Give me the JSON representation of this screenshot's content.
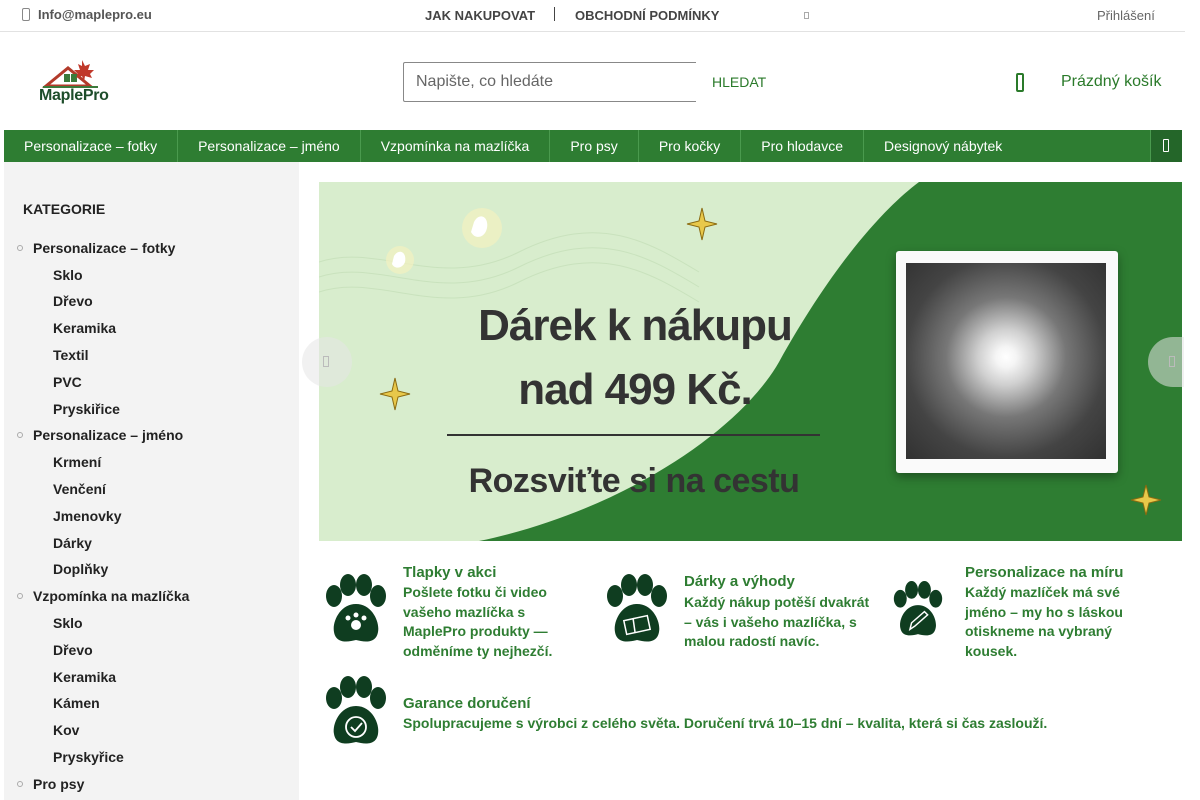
{
  "topbar": {
    "email": "Info@maplepro.eu",
    "links": [
      "JAK NAKUPOVAT",
      "OBCHODNÍ PODMÍNKY"
    ],
    "login": "Přihlášení"
  },
  "header": {
    "logo_text": "MaplePro",
    "search_placeholder": "Napište, co hledáte",
    "search_button": "HLEDAT",
    "cart_label": "Prázdný košík"
  },
  "nav": {
    "items": [
      "Personalizace – fotky",
      "Personalizace – jméno",
      "Vzpomínka na mazlíčka",
      "Pro psy",
      "Pro kočky",
      "Pro hlodavce",
      "Designový nábytek"
    ]
  },
  "sidebar": {
    "heading": "KATEGORIE",
    "categories": [
      {
        "label": "Personalizace – fotky",
        "children": [
          "Sklo",
          "Dřevo",
          "Keramika",
          "Textil",
          "PVC",
          "Pryskiřice"
        ]
      },
      {
        "label": "Personalizace – jméno",
        "children": [
          "Krmení",
          "Venčení",
          "Jmenovky",
          "Dárky",
          "Doplňky"
        ]
      },
      {
        "label": "Vzpomínka na mazlíčka",
        "children": [
          "Sklo",
          "Dřevo",
          "Keramika",
          "Kámen",
          "Kov",
          "Pryskyřice"
        ]
      },
      {
        "label": "Pro psy",
        "children": []
      }
    ]
  },
  "banner": {
    "line1": "Dárek k nákupu",
    "line2": "nad 499 Kč.",
    "line3": "Rozsviťte si na cestu",
    "colors": {
      "light": "#d8edcd",
      "dark": "#2e7d32"
    }
  },
  "features": [
    {
      "icon": "paw-icon",
      "title": "Tlapky v akci",
      "desc": "Pošlete fotku či video vašeho mazlíčka s MaplePro produkty — odměníme ty nejhezčí."
    },
    {
      "icon": "paw-gift-icon",
      "title": "Dárky a výhody",
      "desc": "Každý nákup potěší dvakrát – vás i vašeho mazlíčka, s malou radostí navíc."
    },
    {
      "icon": "paw-pencil-icon",
      "title": "Personalizace na míru",
      "desc": "Každý mazlíček má své jméno – my ho s láskou otiskneme na vybraný kousek."
    },
    {
      "icon": "paw-badge-icon",
      "title": "Garance doručení",
      "desc": "Spolupracujeme s výrobci z celého světa. Doručení trvá 10–15 dní – kvalita, která si čas zaslouží."
    }
  ],
  "theme": {
    "accent": "#2e7d32",
    "sidebar_bg": "#f3f3f3"
  }
}
